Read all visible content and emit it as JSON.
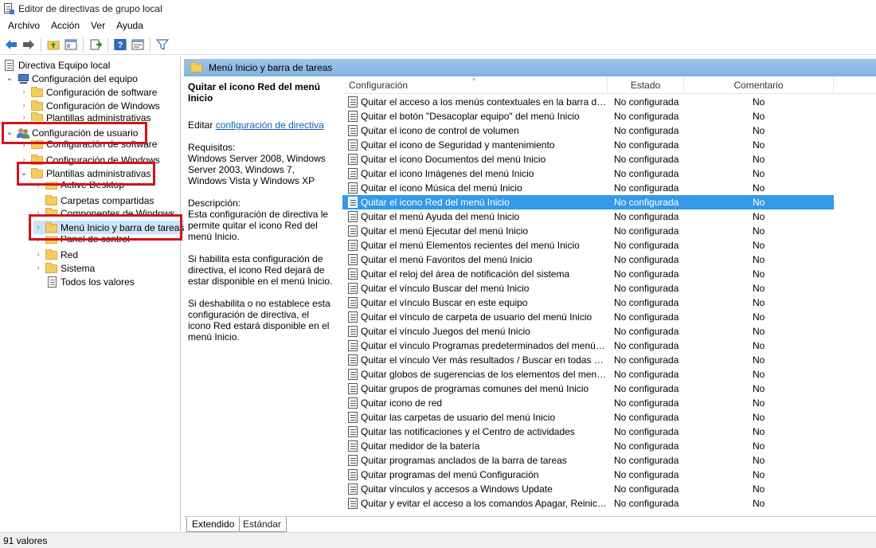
{
  "window": {
    "title": "Editor de directivas de grupo local"
  },
  "menubar": [
    "Archivo",
    "Acción",
    "Ver",
    "Ayuda"
  ],
  "tree": [
    {
      "label": "Directiva Equipo local"
    },
    {
      "label": "Configuración del equipo"
    },
    {
      "label": "Configuración de software"
    },
    {
      "label": "Configuración de Windows"
    },
    {
      "label": "Plantillas administrativas"
    },
    {
      "label": "Configuración de usuario"
    },
    {
      "label": "Configuración de software"
    },
    {
      "label": "Configuración de Windows"
    },
    {
      "label": "Plantillas administrativas"
    },
    {
      "label": "Active Desktop"
    },
    {
      "label": "Carpetas compartidas"
    },
    {
      "label": "Componentes de Windows"
    },
    {
      "label": "Menú Inicio y barra de tareas"
    },
    {
      "label": "Panel de control"
    },
    {
      "label": "Red"
    },
    {
      "label": "Sistema"
    },
    {
      "label": "Todos los valores"
    }
  ],
  "panel": {
    "header": "Menú Inicio y barra de tareas"
  },
  "description": {
    "title": "Quitar el icono Red del menú Inicio",
    "edit_prefix": "Editar",
    "edit_link": "configuración de directiva",
    "requirements_label": "Requisitos:",
    "requirements": "Windows Server 2008, Windows Server 2003, Windows 7, Windows Vista y Windows XP",
    "description_label": "Descripción:",
    "description": "Esta configuración de directiva le permite quitar el icono Red del menú Inicio.",
    "enabled": "Si habilita esta configuración de directiva, el icono Red dejará de estar disponible en el menú Inicio.",
    "disabled": "Si deshabilita o no establece esta configuración de directiva, el icono Red estará disponible en el menú Inicio."
  },
  "columns": {
    "name": "Configuración",
    "state": "Estado",
    "comment": "Comentario"
  },
  "rows": [
    {
      "name": "Quitar el acceso a los menús contextuales en la barra de tare...",
      "state": "No configurada",
      "comment": "No"
    },
    {
      "name": "Quitar el botón \"Desacoplar equipo\" del menú Inicio",
      "state": "No configurada",
      "comment": "No"
    },
    {
      "name": "Quitar el icono de control de volumen",
      "state": "No configurada",
      "comment": "No"
    },
    {
      "name": "Quitar el icono de Seguridad y mantenimiento",
      "state": "No configurada",
      "comment": "No"
    },
    {
      "name": "Quitar el icono Documentos del menú Inicio",
      "state": "No configurada",
      "comment": "No"
    },
    {
      "name": "Quitar el icono Imágenes del menú Inicio",
      "state": "No configurada",
      "comment": "No"
    },
    {
      "name": "Quitar el icono Música del menú Inicio",
      "state": "No configurada",
      "comment": "No"
    },
    {
      "name": "Quitar el icono Red del menú Inicio",
      "state": "No configurada",
      "comment": "No",
      "selected": true
    },
    {
      "name": "Quitar el menú Ayuda del menú Inicio",
      "state": "No configurada",
      "comment": "No"
    },
    {
      "name": "Quitar el menú Ejecutar del menú Inicio",
      "state": "No configurada",
      "comment": "No"
    },
    {
      "name": "Quitar el menú Elementos recientes del menú Inicio",
      "state": "No configurada",
      "comment": "No"
    },
    {
      "name": "Quitar el menú Favoritos del menú Inicio",
      "state": "No configurada",
      "comment": "No"
    },
    {
      "name": "Quitar el reloj del área de notificación del sistema",
      "state": "No configurada",
      "comment": "No"
    },
    {
      "name": "Quitar el vínculo Buscar del menú Inicio",
      "state": "No configurada",
      "comment": "No"
    },
    {
      "name": "Quitar el vínculo Buscar en este equipo",
      "state": "No configurada",
      "comment": "No"
    },
    {
      "name": "Quitar el vínculo de carpeta de usuario del menú Inicio",
      "state": "No configurada",
      "comment": "No"
    },
    {
      "name": "Quitar el vínculo Juegos del menú Inicio",
      "state": "No configurada",
      "comment": "No"
    },
    {
      "name": "Quitar el vínculo Programas predeterminados del menú Inicio",
      "state": "No configurada",
      "comment": "No"
    },
    {
      "name": "Quitar el vínculo Ver más resultados / Buscar en todas partes",
      "state": "No configurada",
      "comment": "No"
    },
    {
      "name": "Quitar globos de sugerencias de los elementos del menú Ini...",
      "state": "No configurada",
      "comment": "No"
    },
    {
      "name": "Quitar grupos de programas comunes del menú Inicio",
      "state": "No configurada",
      "comment": "No"
    },
    {
      "name": "Quitar icono de red",
      "state": "No configurada",
      "comment": "No"
    },
    {
      "name": "Quitar las carpetas de usuario del menú Inicio",
      "state": "No configurada",
      "comment": "No"
    },
    {
      "name": "Quitar las notificaciones y el Centro de actividades",
      "state": "No configurada",
      "comment": "No"
    },
    {
      "name": "Quitar medidor de la batería",
      "state": "No configurada",
      "comment": "No"
    },
    {
      "name": "Quitar programas anclados de la barra de tareas",
      "state": "No configurada",
      "comment": "No"
    },
    {
      "name": "Quitar programas del menú Configuración",
      "state": "No configurada",
      "comment": "No"
    },
    {
      "name": "Quitar vínculos y accesos a Windows Update",
      "state": "No configurada",
      "comment": "No"
    },
    {
      "name": "Quitar y evitar el acceso a los comandos Apagar, Reiniciar, S...",
      "state": "No configurada",
      "comment": "No"
    }
  ],
  "tabs": [
    "Extendido",
    "Estándar"
  ],
  "status": {
    "text": "91 valores"
  },
  "colors": {
    "highlight": "#d1141e",
    "selection": "#3399e8",
    "header": "#9ec5ea"
  }
}
